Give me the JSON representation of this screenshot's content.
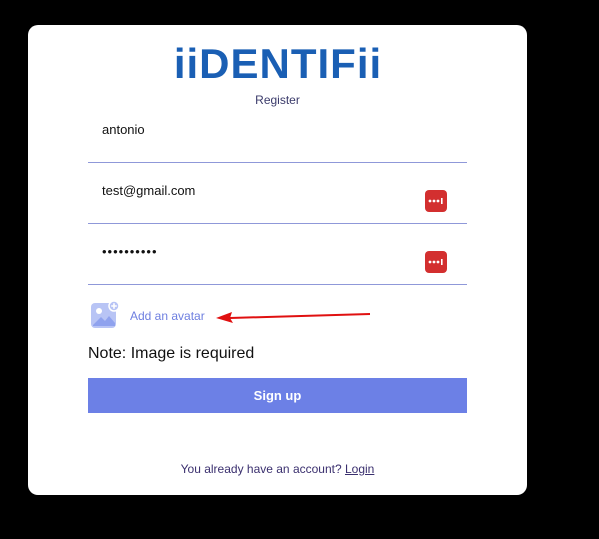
{
  "brand": {
    "logo_text": "iiDENTIFii",
    "logo_color": "#1a5fb4"
  },
  "form": {
    "subtitle": "Register",
    "username_value": "antonio",
    "email_value": "test@gmail.com",
    "password_value": "••••••••••",
    "key_icon": "password-manager-icon",
    "key_color": "#d32f2f",
    "avatar_label": "Add an avatar",
    "note": "Note: Image is required",
    "signup_label": "Sign up",
    "signup_color": "#6c80e6"
  },
  "footer": {
    "prompt": "You already have an account?",
    "login_link": "Login"
  }
}
